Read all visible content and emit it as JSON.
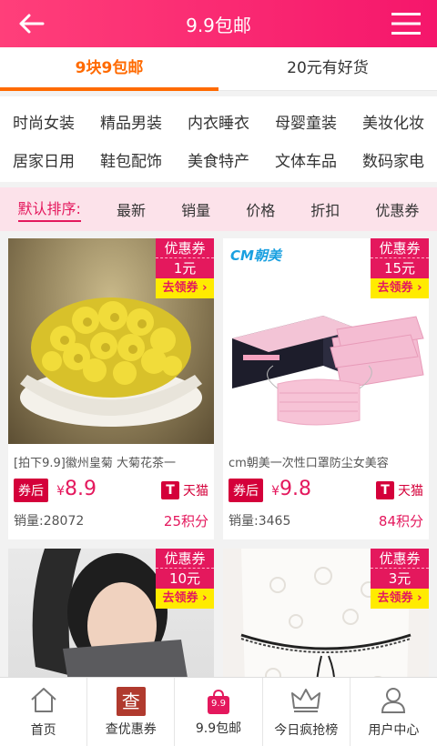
{
  "header": {
    "title": "9.9包邮",
    "back_icon": "back-arrow-icon",
    "menu_icon": "hamburger-menu-icon"
  },
  "tabs": [
    {
      "label": "9块9包邮"
    },
    {
      "label": "20元有好货"
    }
  ],
  "categories": {
    "row1": [
      "时尚女装",
      "精品男装",
      "内衣睡衣",
      "母婴童装",
      "美妆化妆"
    ],
    "row2": [
      "居家日用",
      "鞋包配饰",
      "美食特产",
      "文体车品",
      "数码家电"
    ]
  },
  "sort": [
    "默认排序:",
    "最新",
    "销量",
    "价格",
    "折扣",
    "优惠券"
  ],
  "colors": {
    "brand": "#f5166b",
    "tab_active": "#ff6a00",
    "coupon_bg": "#e4185d",
    "coupon_get": "#ffeb00"
  },
  "products": [
    {
      "name": "[拍下9.9]徽州皇菊 大菊花茶一",
      "coupon_title": "优惠券",
      "coupon_amount": "1元",
      "coupon_get": "去领券 ›",
      "after_label": "券后",
      "currency": "¥",
      "price": "8.9",
      "shop": "天猫",
      "shop_icon": "T",
      "sales": "销量:28072",
      "points": "25积分"
    },
    {
      "name": "cm朝美一次性口罩防尘女美容",
      "coupon_title": "优惠券",
      "coupon_amount": "15元",
      "coupon_get": "去领券 ›",
      "after_label": "券后",
      "currency": "¥",
      "price": "9.8",
      "shop": "天猫",
      "shop_icon": "T",
      "sales": "销量:3465",
      "points": "84积分",
      "brand_logo": "CM朝美"
    },
    {
      "coupon_title": "优惠券",
      "coupon_amount": "10元",
      "coupon_get": "去领券 ›"
    },
    {
      "coupon_title": "优惠券",
      "coupon_amount": "3元",
      "coupon_get": "去领券 ›"
    }
  ],
  "bottom_nav": [
    {
      "label": "首页",
      "icon": "home-icon"
    },
    {
      "label": "查优惠券",
      "icon": "search-coupon-icon",
      "icon_text": "查"
    },
    {
      "label": "9.9包邮",
      "icon": "shopping-bag-icon",
      "icon_text": "9.9"
    },
    {
      "label": "今日疯抢榜",
      "icon": "crown-icon"
    },
    {
      "label": "用户中心",
      "icon": "user-icon"
    }
  ]
}
